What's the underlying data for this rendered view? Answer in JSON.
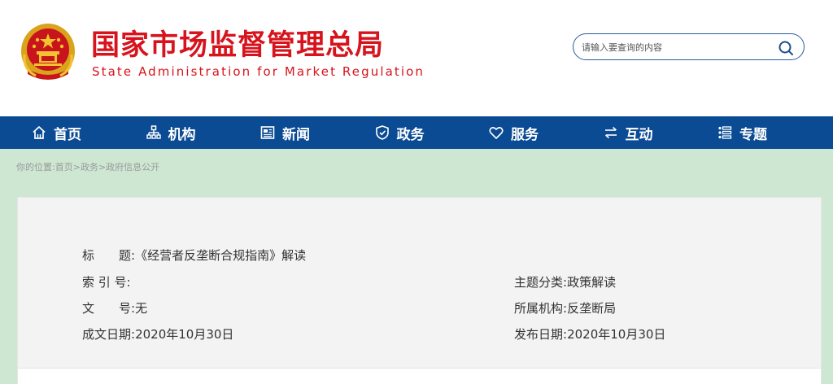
{
  "brand": {
    "name_cn": "国家市场监督管理总局",
    "name_en": "State Administration for Market Regulation",
    "emblem_icon": "national-emblem-icon"
  },
  "search": {
    "placeholder": "请输入要查询的内容",
    "icon": "search-icon"
  },
  "nav": {
    "items": [
      {
        "label": "首页",
        "icon": "home-icon"
      },
      {
        "label": "机构",
        "icon": "org-chart-icon"
      },
      {
        "label": "新闻",
        "icon": "newspaper-icon"
      },
      {
        "label": "政务",
        "icon": "shield-icon"
      },
      {
        "label": "服务",
        "icon": "heart-icon"
      },
      {
        "label": "互动",
        "icon": "exchange-icon"
      },
      {
        "label": "专题",
        "icon": "topics-icon"
      }
    ]
  },
  "breadcrumb": {
    "prefix": "你的位置:",
    "items": [
      "首页",
      "政务",
      "政府信息公开"
    ],
    "separator": ">"
  },
  "meta": {
    "title_label": "标　　题:",
    "title_value": "《经营者反垄断合规指南》解读",
    "index_label": "索 引 号:",
    "index_value": "",
    "docno_label": "文　　号:",
    "docno_value": "无",
    "created_label": "成文日期:",
    "created_value": "2020年10月30日",
    "category_label": "主题分类:",
    "category_value": "政策解读",
    "org_label": "所属机构:",
    "org_value": "反垄断局",
    "published_label": "发布日期:",
    "published_value": "2020年10月30日"
  },
  "colors": {
    "brand_red": "#d7141d",
    "nav_blue": "#0b4b94",
    "body_green": "#cde7d3"
  }
}
